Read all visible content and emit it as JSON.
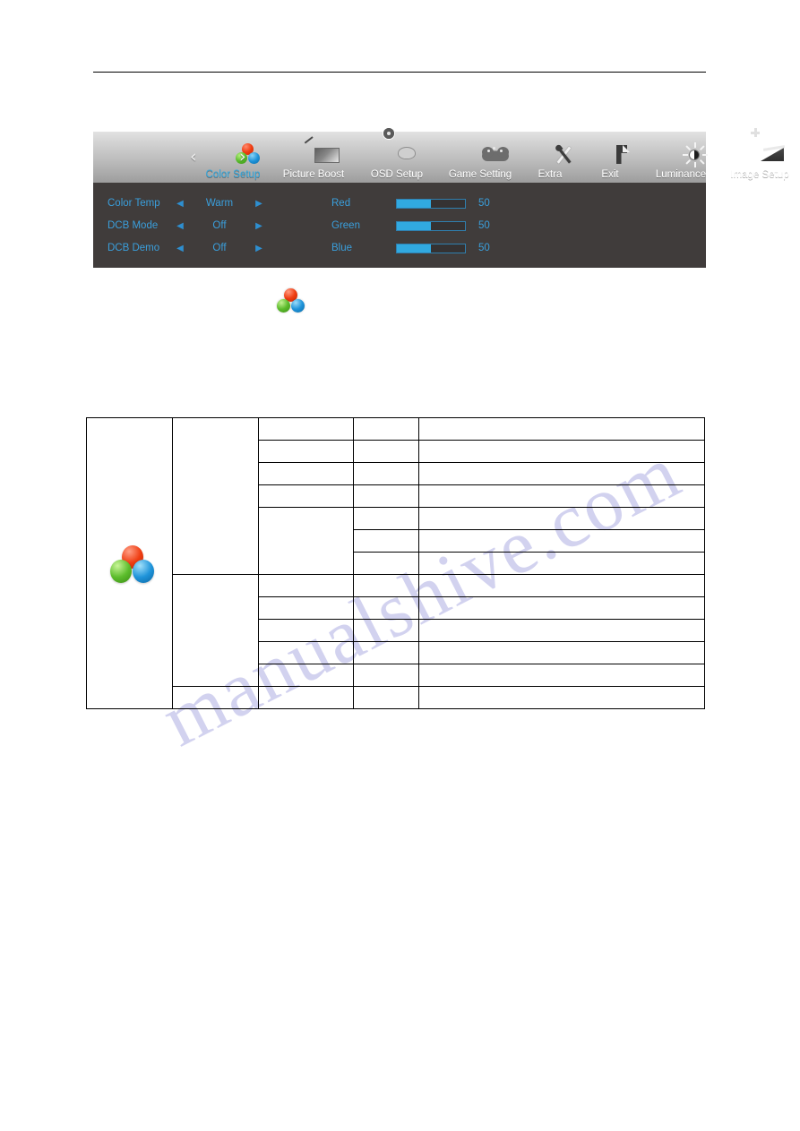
{
  "osd": {
    "selected_menu": "Color Setup",
    "nav_prev_icon": "chevron-left-icon",
    "nav_next_icon": "chevron-right-icon",
    "menu_items": [
      {
        "label": "Color Setup",
        "icon": "rgb-balls-icon",
        "selected": true
      },
      {
        "label": "Picture Boost",
        "icon": "picture-boost-icon",
        "selected": false
      },
      {
        "label": "OSD Setup",
        "icon": "osd-setup-icon",
        "selected": false
      },
      {
        "label": "Game Setting",
        "icon": "gamepad-icon",
        "selected": false
      },
      {
        "label": "Extra",
        "icon": "tools-icon",
        "selected": false
      },
      {
        "label": "Exit",
        "icon": "exit-icon",
        "selected": false
      },
      {
        "label": "Luminance",
        "icon": "brightness-sun-icon",
        "selected": false
      },
      {
        "label": "Image Setup",
        "icon": "image-setup-icon",
        "selected": false
      }
    ],
    "options": [
      {
        "label": "Color Temp",
        "value": "Warm",
        "left_arrow": "◀",
        "right_arrow": "▶"
      },
      {
        "label": "DCB Mode",
        "value": "Off",
        "left_arrow": "◀",
        "right_arrow": "▶"
      },
      {
        "label": "DCB Demo",
        "value": "Off",
        "left_arrow": "◀",
        "right_arrow": "▶"
      }
    ],
    "sliders": [
      {
        "label": "Red",
        "value": "50",
        "percent": 50
      },
      {
        "label": "Green",
        "value": "50",
        "percent": 50
      },
      {
        "label": "Blue",
        "value": "50",
        "percent": 50
      }
    ],
    "colors": {
      "accent_blue": "#3a9fdc",
      "slider_fill": "#31a9e0",
      "panel_bg": "#403c3b"
    }
  },
  "section_icon": {
    "name": "rgb-balls-icon"
  },
  "watermark": {
    "text": "manualshive.com"
  },
  "spec_table": {
    "rows": [
      {
        "c1": "",
        "c2": "",
        "c3": "",
        "c4": "",
        "c5": ""
      },
      {
        "c1": "",
        "c2": "",
        "c3": "",
        "c4": "",
        "c5": ""
      },
      {
        "c1": "",
        "c2": "",
        "c3": "",
        "c4": "",
        "c5": ""
      },
      {
        "c1": "",
        "c2": "",
        "c3": "",
        "c4": "",
        "c5": ""
      },
      {
        "c1": "",
        "c2": "",
        "c3": "",
        "c4": "",
        "c5": ""
      },
      {
        "c1": "",
        "c2": "",
        "c3": "",
        "c4": "",
        "c5": ""
      },
      {
        "c1": "",
        "c2": "",
        "c3": "",
        "c4": "",
        "c5": ""
      },
      {
        "c1": "",
        "c2": "",
        "c3": "",
        "c4": "",
        "c5": ""
      },
      {
        "c1": "",
        "c2": "",
        "c3": "",
        "c4": "",
        "c5": ""
      },
      {
        "c1": "",
        "c2": "",
        "c3": "",
        "c4": "",
        "c5": ""
      },
      {
        "c1": "",
        "c2": "",
        "c3": "",
        "c4": "",
        "c5": ""
      },
      {
        "c1": "",
        "c2": "",
        "c3": "",
        "c4": "",
        "c5": ""
      },
      {
        "c1": "",
        "c2": "",
        "c3": "",
        "c4": "",
        "c5": ""
      }
    ]
  }
}
